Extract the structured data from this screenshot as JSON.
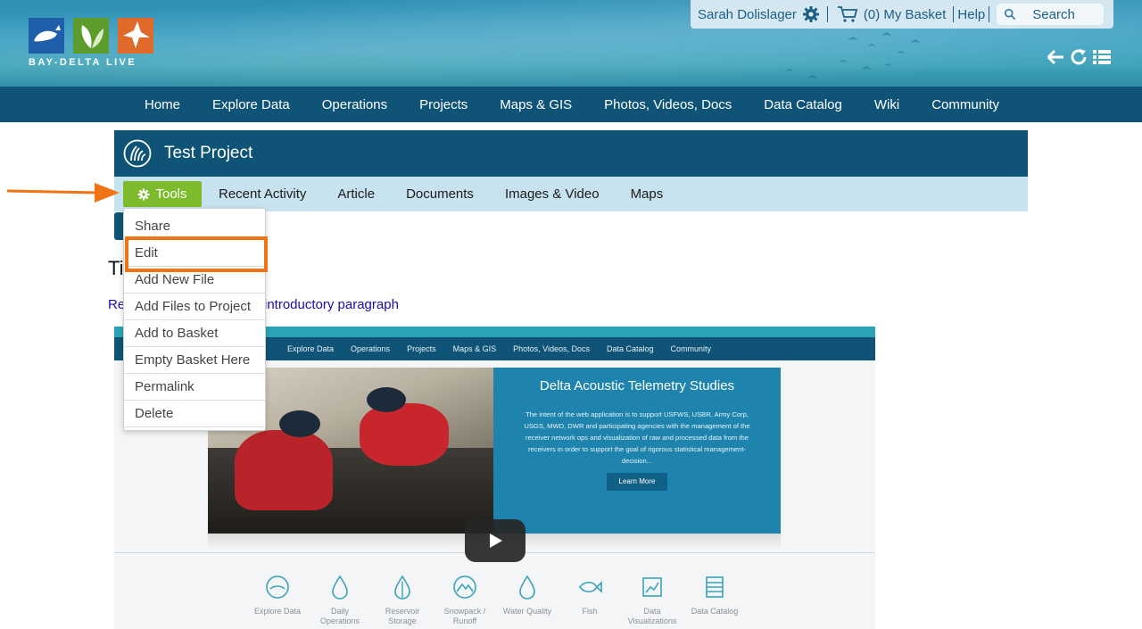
{
  "brand": {
    "logo_text": "BAY-DELTA LIVE"
  },
  "utility": {
    "user_name": "Sarah Dolislager",
    "basket_label": "(0) My Basket",
    "help_label": "Help",
    "search_placeholder": "Search"
  },
  "main_nav": [
    "Home",
    "Explore Data",
    "Operations",
    "Projects",
    "Maps & GIS",
    "Photos, Videos, Docs",
    "Data Catalog",
    "Wiki",
    "Community"
  ],
  "project": {
    "title": "Test Project",
    "tools_label": "Tools",
    "tabs": [
      "Recent Activity",
      "Article",
      "Documents",
      "Images & Video",
      "Maps"
    ]
  },
  "tools_menu": [
    "Share",
    "Edit",
    "Add New File",
    "Add Files to Project",
    "Add to Basket",
    "Empty Basket Here",
    "Permalink",
    "Delete"
  ],
  "content": {
    "title_partial": "Ti",
    "link_lead": "Re",
    "link_tail": "introductory paragraph"
  },
  "video": {
    "nav": [
      "Explore Data",
      "Operations",
      "Projects",
      "Maps & GIS",
      "Photos, Videos, Docs",
      "Data Catalog",
      "Community"
    ],
    "panel_title": "Delta Acoustic Telemetry Studies",
    "panel_text": "The intent of the web application is to support USFWS, USBR, Army Corp, USGS, MWD, DWR and participating agencies with the management of the receiver network ops and visualization of raw and processed data from the receivers in order to support the goal of rigorous statistical management-decision...",
    "learn_more": "Learn More",
    "icons": [
      {
        "label": "Explore Data",
        "icon": "globe-icon"
      },
      {
        "label": "Daily Operations",
        "icon": "drop-icon"
      },
      {
        "label": "Reservoir Storage",
        "icon": "reservoir-icon"
      },
      {
        "label": "Snowpack / Runoff",
        "icon": "mountain-icon"
      },
      {
        "label": "Water Quality",
        "icon": "water-drop-icon"
      },
      {
        "label": "Fish",
        "icon": "fish-icon"
      },
      {
        "label": "Data Visualizations",
        "icon": "chart-icon"
      },
      {
        "label": "Data Catalog",
        "icon": "catalog-icon"
      }
    ]
  },
  "colors": {
    "nav_bg": "#0f5477",
    "subnav_bg": "#c7e3ef",
    "tools_green": "#7dbb2d",
    "annotation_orange": "#f07314"
  }
}
